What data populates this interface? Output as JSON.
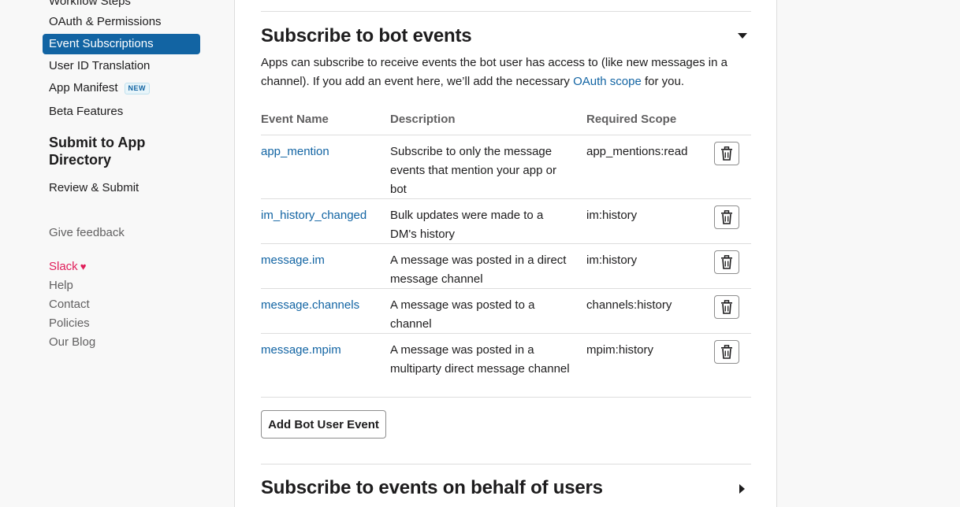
{
  "sidebar": {
    "items": [
      {
        "label": "Workflow Steps",
        "active": false
      },
      {
        "label": "OAuth & Permissions",
        "active": false
      },
      {
        "label": "Event Subscriptions",
        "active": true
      },
      {
        "label": "User ID Translation",
        "active": false
      },
      {
        "label": "App Manifest",
        "badge": "NEW",
        "active": false
      },
      {
        "label": "Beta Features",
        "active": false
      }
    ],
    "submit_heading": "Submit to App Directory",
    "review_label": "Review & Submit",
    "give_feedback": "Give feedback",
    "footer": {
      "slack": "Slack",
      "heart": "♥",
      "help": "Help",
      "contact": "Contact",
      "policies": "Policies",
      "blog": "Our Blog"
    }
  },
  "bot_events": {
    "title": "Subscribe to bot events",
    "intro_before": "Apps can subscribe to receive events the bot user has access to (like new messages in a channel). If you add an event here, we’ll add the necessary ",
    "intro_link": "OAuth scope",
    "intro_after": " for you.",
    "columns": {
      "event_name": "Event Name",
      "description": "Description",
      "required_scope": "Required Scope"
    },
    "events": [
      {
        "name": "app_mention",
        "description": "Subscribe to only the message events that mention your app or bot",
        "scope": "app_mentions:read"
      },
      {
        "name": "im_history_changed",
        "description": "Bulk updates were made to a DM's history",
        "scope": "im:history"
      },
      {
        "name": "message.im",
        "description": "A message was posted in a direct message channel",
        "scope": "im:history"
      },
      {
        "name": "message.channels",
        "description": "A message was posted to a channel",
        "scope": "channels:history"
      },
      {
        "name": "message.mpim",
        "description": "A message was posted in a multiparty direct message channel",
        "scope": "mpim:history"
      }
    ],
    "add_button": "Add Bot User Event"
  },
  "user_events": {
    "title": "Subscribe to events on behalf of users"
  },
  "icons": {
    "collapse": "caret-down-icon",
    "expand": "caret-right-icon",
    "remove": "trash-icon"
  },
  "colors": {
    "accent": "#1264a3",
    "slack_pink": "#e01e5a",
    "muted_text": "#616061"
  }
}
